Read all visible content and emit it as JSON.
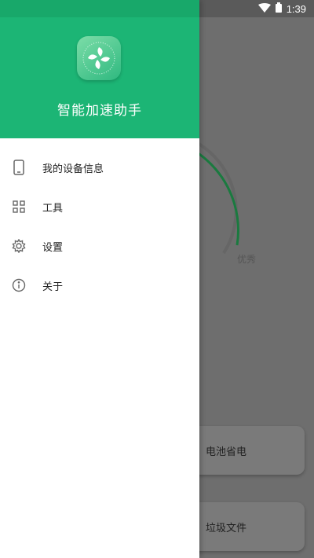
{
  "status_bar": {
    "time": "1:39"
  },
  "drawer": {
    "app_title": "智能加速助手",
    "menu": [
      {
        "label": "我的设备信息",
        "icon": "phone-icon"
      },
      {
        "label": "工具",
        "icon": "grid-icon"
      },
      {
        "label": "设置",
        "icon": "gear-icon"
      },
      {
        "label": "关于",
        "icon": "info-icon"
      }
    ]
  },
  "background": {
    "rating_label": "优秀",
    "cards": [
      {
        "label": "电池省电"
      },
      {
        "label": "垃圾文件"
      }
    ]
  },
  "colors": {
    "header_green": "#1cb575",
    "ring_green": "#1a7a3f"
  }
}
